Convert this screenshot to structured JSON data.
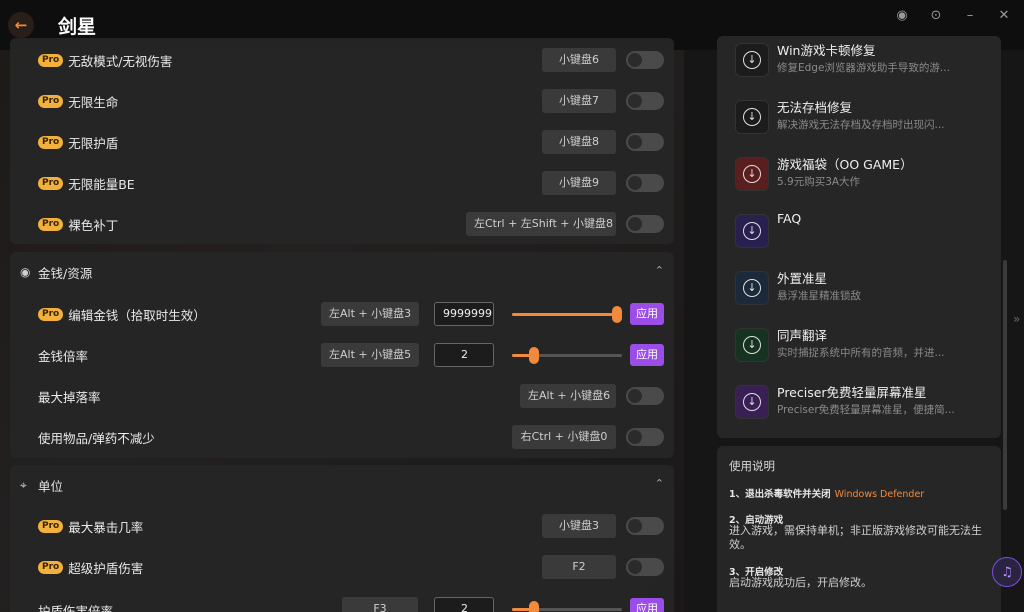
{
  "window": {
    "title": "剑星",
    "back_glyph": "←"
  },
  "win_controls": [
    {
      "name": "user-icon",
      "glyph": "◉"
    },
    {
      "name": "settings-icon",
      "glyph": "⊙"
    },
    {
      "name": "minimize-icon",
      "glyph": "–"
    },
    {
      "name": "close-icon",
      "glyph": "✕"
    }
  ],
  "pro_label": "Pro",
  "top_group": {
    "rows": [
      {
        "label": "无敌模式/无视伤害",
        "pro": true,
        "hotkey": "小键盘6"
      },
      {
        "label": "无限生命",
        "pro": true,
        "hotkey": "小键盘7"
      },
      {
        "label": "无限护盾",
        "pro": true,
        "hotkey": "小键盘8"
      },
      {
        "label": "无限能量BE",
        "pro": true,
        "hotkey": "小键盘9"
      },
      {
        "label": "裸色补丁",
        "pro": true,
        "hotkey": "左Ctrl + 左Shift + 小键盘8"
      }
    ]
  },
  "money_section": {
    "title": "金钱/资源",
    "icon": "money-bag-icon",
    "rows": [
      {
        "label": "编辑金钱（拾取时生效）",
        "pro": true,
        "hotkey": "左Alt + 小键盘3",
        "value": "9999999",
        "slider_fraction": 1.0,
        "apply": "应用"
      },
      {
        "label": "金钱倍率",
        "pro": false,
        "hotkey": "左Alt + 小键盘5",
        "value": "2",
        "slider_fraction": 0.2,
        "apply": "应用"
      },
      {
        "label": "最大掉落率",
        "pro": false,
        "hotkey": "左Alt + 小键盘6"
      },
      {
        "label": "使用物品/弹药不减少",
        "pro": false,
        "hotkey": "右Ctrl + 小键盘0"
      }
    ]
  },
  "unit_section": {
    "title": "单位",
    "icon": "unit-icon",
    "rows": [
      {
        "label": "最大暴击几率",
        "pro": true,
        "hotkey": "小键盘3"
      },
      {
        "label": "超级护盾伤害",
        "pro": true,
        "hotkey": "F2"
      },
      {
        "label": "护盾伤害倍率",
        "pro": false,
        "hotkey": "F3",
        "value": "2",
        "slider_fraction": 0.2,
        "apply": "应用"
      }
    ]
  },
  "tools": [
    {
      "title": "Win游戏卡顿修复",
      "desc": "修复Edge浏览器游戏助手导致的游...",
      "icon_bg": "#1c1c1c"
    },
    {
      "title": "无法存档修复",
      "desc": "解决游戏无法存档及存档时出现闪...",
      "icon_bg": "#1c1c1c"
    },
    {
      "title": "游戏福袋（OO GAME）",
      "desc": "5.9元购买3A大作",
      "icon_bg": "#5a1e1e"
    },
    {
      "title": "FAQ",
      "desc": "",
      "icon_bg": "#2a2050"
    },
    {
      "title": "外置准星",
      "desc": "悬浮准星精准锁敌",
      "icon_bg": "#1b2a3a"
    },
    {
      "title": "同声翻译",
      "desc": "实时捕捉系统中所有的音频，并进...",
      "icon_bg": "#163322"
    },
    {
      "title": "Preciser免费轻量屏幕准星",
      "desc": "Preciser免费轻量屏幕准星，便捷简...",
      "icon_bg": "#3a1f55"
    }
  ],
  "usage": {
    "title": "使用说明",
    "step1": "1、退出杀毒软件并关闭",
    "step1_accent": "Windows Defender",
    "step2": "2、启动游戏",
    "step2_text": "进入游戏，需保持单机；非正版游戏修改可能无法生效。",
    "step3": "3、开启修改",
    "step3_text": "启动游戏成功后，开启修改。"
  },
  "colors": {
    "accent": "#f28a3c",
    "purple": "#9b4de8",
    "pro_badge": "#f2b03c"
  }
}
